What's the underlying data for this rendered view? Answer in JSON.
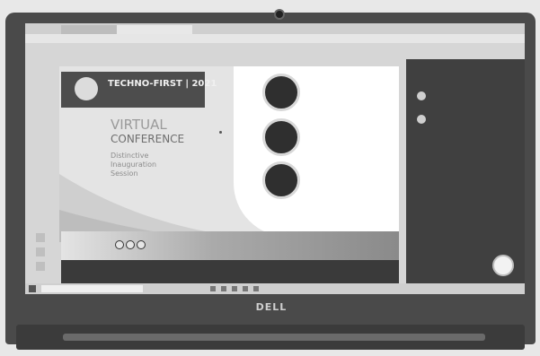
{
  "device": {
    "brand": "DELL"
  },
  "browser": {
    "tabs": [
      {
        "label": ""
      },
      {
        "label": ""
      }
    ],
    "bookmarks": [
      "",
      "",
      "",
      "",
      "",
      "",
      "",
      ""
    ]
  },
  "slide": {
    "header_title": "TECHNO-FIRST | 2021",
    "header_subtitle": "",
    "title_line1": "VIRTUAL",
    "title_line2": "CONFERENCE",
    "topic_line1": "Distinctive",
    "topic_line2": "Inauguration",
    "topic_line3": "Session",
    "speakers": [
      {
        "role": "",
        "description": ""
      },
      {
        "role": "",
        "description": ""
      },
      {
        "role": "",
        "description": ""
      }
    ],
    "footer_dates": [
      "",
      "",
      ""
    ]
  },
  "side_panel": {
    "lines": [
      "",
      "",
      "",
      ""
    ]
  },
  "taskbar": {
    "search_placeholder": "",
    "clock": ""
  },
  "colors": {
    "screen_bezel": "#4a4a4a",
    "slide_header": "#4d4d4d",
    "side_panel": "#404040"
  }
}
